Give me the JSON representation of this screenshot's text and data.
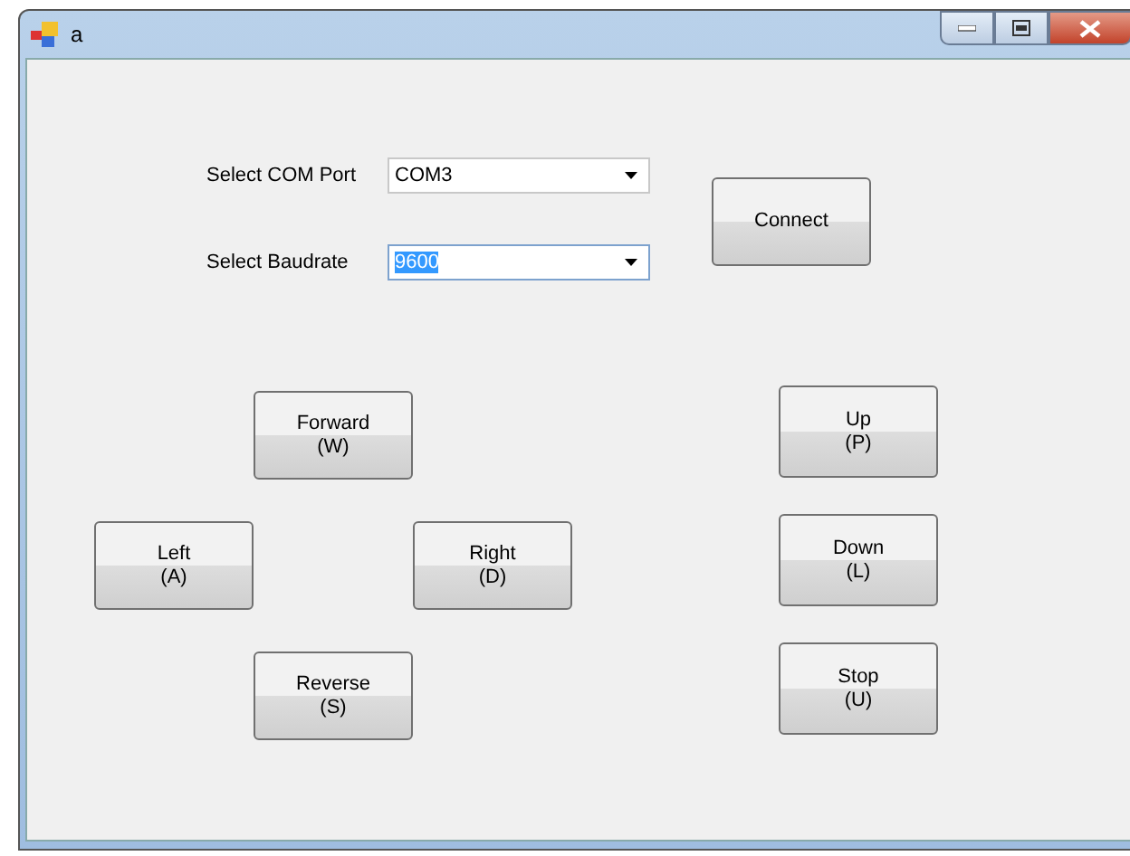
{
  "window": {
    "title": "a"
  },
  "port": {
    "label": "Select COM Port",
    "value": "COM3",
    "text_selected": false
  },
  "baud": {
    "label": "Select Baudrate",
    "value": "9600",
    "text_selected": true
  },
  "connect": {
    "label": "Connect"
  },
  "drive_buttons": [
    {
      "label": "Forward",
      "key": "(W)"
    },
    {
      "label": "Left",
      "key": "(A)"
    },
    {
      "label": "Right",
      "key": "(D)"
    },
    {
      "label": "Reverse",
      "key": "(S)"
    }
  ],
  "arm_buttons": [
    {
      "label": "Up",
      "key": "(P)"
    },
    {
      "label": "Down",
      "key": "(L)"
    },
    {
      "label": "Stop",
      "key": "(U)"
    }
  ]
}
